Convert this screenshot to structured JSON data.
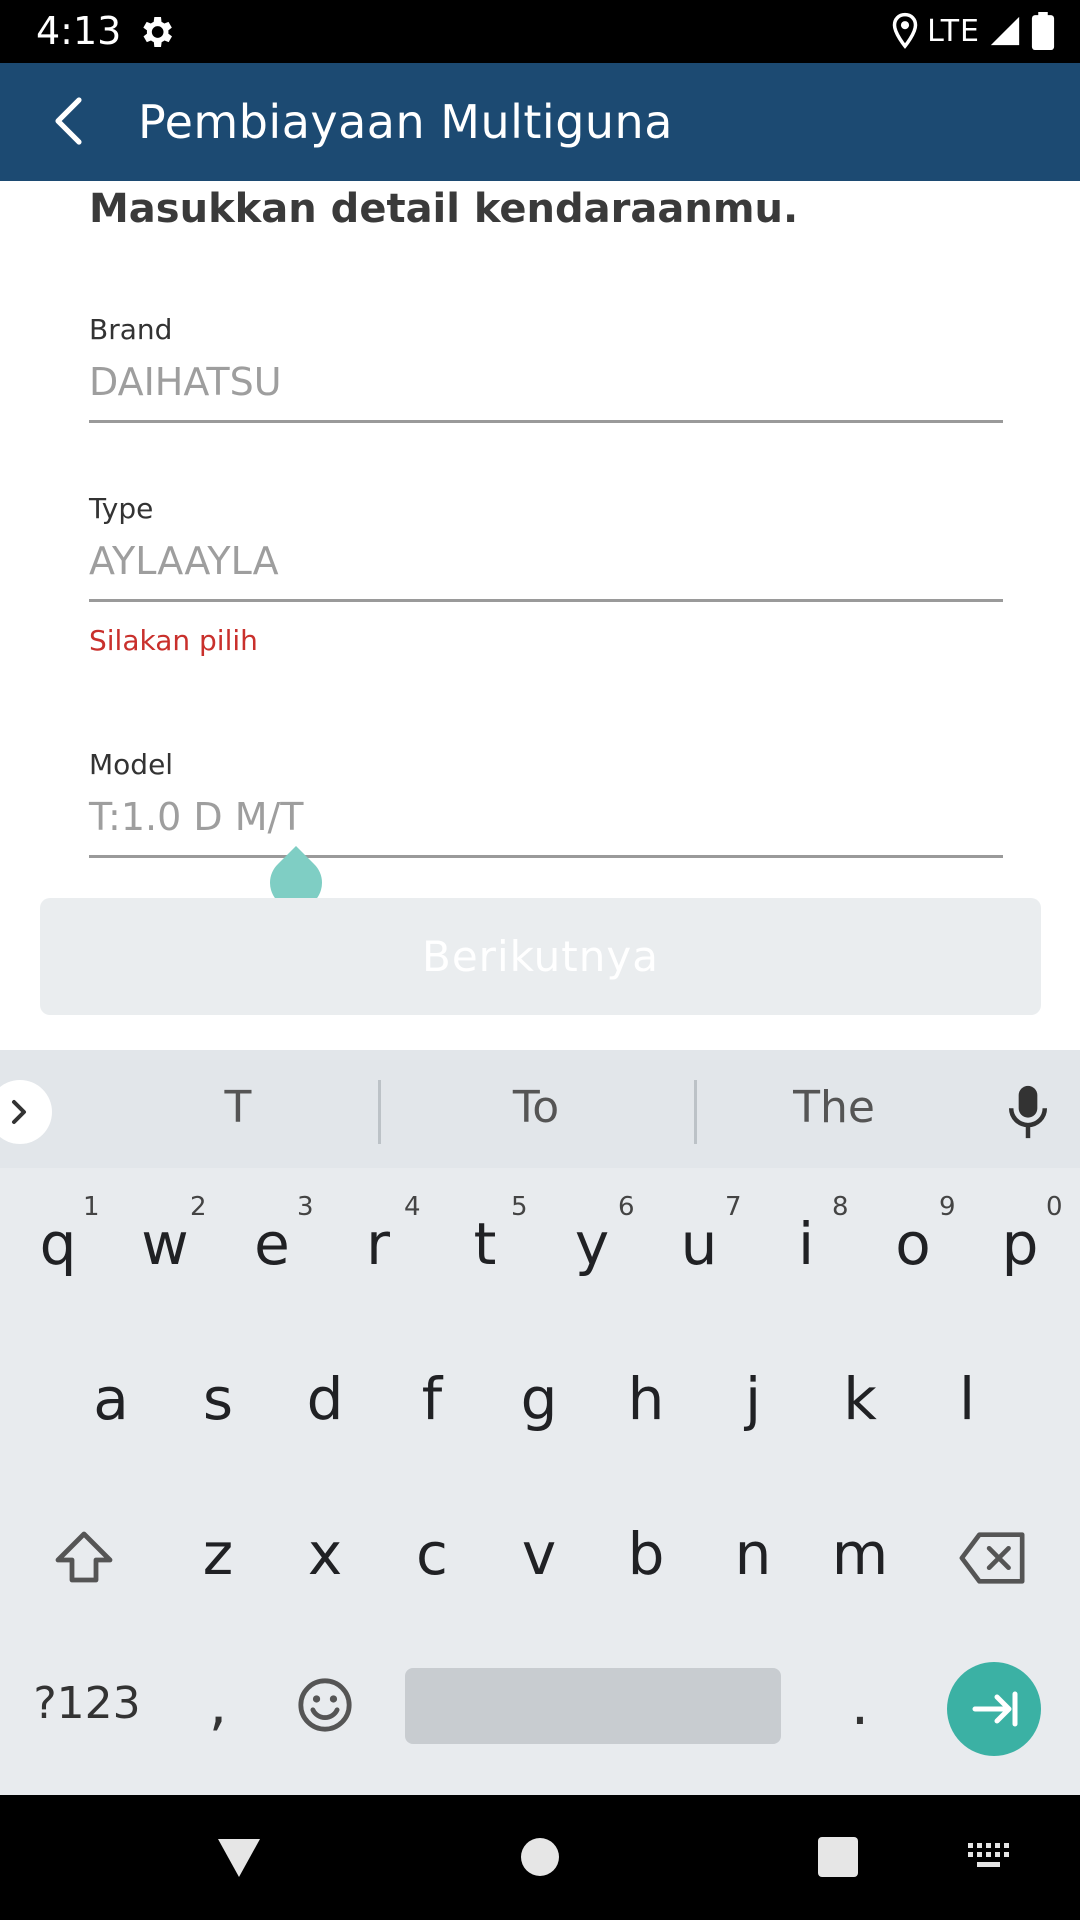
{
  "status_bar": {
    "time": "4:13",
    "network": "LTE"
  },
  "app_bar": {
    "title": "Pembiayaan Multiguna"
  },
  "form": {
    "heading": "Masukkan detail kendaraanmu.",
    "brand": {
      "label": "Brand",
      "value": "DAIHATSU"
    },
    "type": {
      "label": "Type",
      "value": "AYLAAYLA",
      "error": "Silakan pilih"
    },
    "model": {
      "label": "Model",
      "value": "T:1.0 D M/T"
    },
    "next_label": "Berikutnya"
  },
  "keyboard": {
    "suggestions": [
      "T",
      "To",
      "The"
    ],
    "row1": [
      "q",
      "w",
      "e",
      "r",
      "t",
      "y",
      "u",
      "i",
      "o",
      "p"
    ],
    "row1_hints": [
      "1",
      "2",
      "3",
      "4",
      "5",
      "6",
      "7",
      "8",
      "9",
      "0"
    ],
    "row2": [
      "a",
      "s",
      "d",
      "f",
      "g",
      "h",
      "j",
      "k",
      "l"
    ],
    "row3": [
      "z",
      "x",
      "c",
      "v",
      "b",
      "n",
      "m"
    ],
    "symbols_key": "?123",
    "comma_key": ",",
    "period_key": ".",
    "accent_color": "#3bb1a4"
  },
  "colors": {
    "app_bar": "#1c4a72",
    "error": "#c9302c"
  }
}
